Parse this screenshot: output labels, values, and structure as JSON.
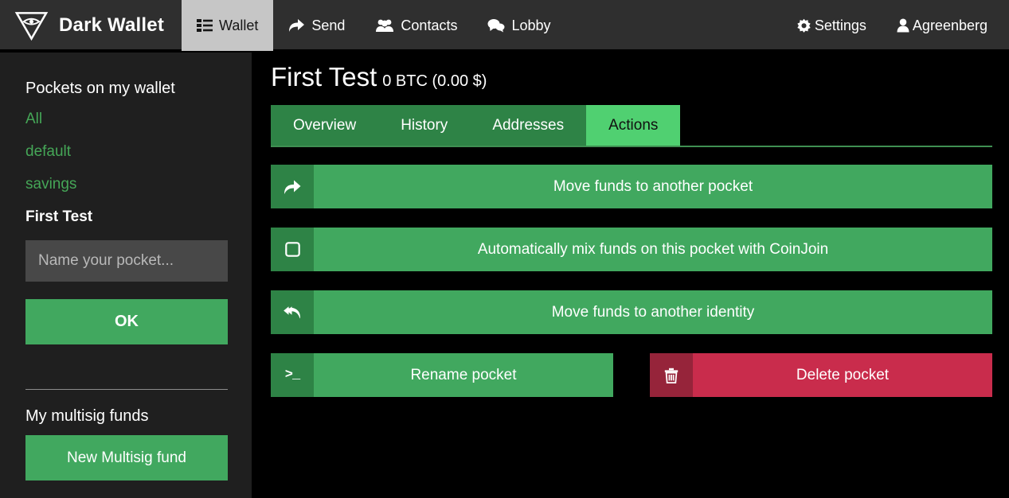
{
  "navbar": {
    "brand": "Dark Wallet",
    "brand_logo_icon": "triangle-eye-logo-icon",
    "items": [
      {
        "label": "Wallet",
        "icon": "list-icon",
        "active": true
      },
      {
        "label": "Send",
        "icon": "share-icon",
        "active": false
      },
      {
        "label": "Contacts",
        "icon": "users-icon",
        "active": false
      },
      {
        "label": "Lobby",
        "icon": "comments-icon",
        "active": false
      }
    ],
    "right_items": [
      {
        "label": "Settings",
        "icon": "gear-icon"
      },
      {
        "label": "Agreenberg",
        "icon": "user-icon"
      }
    ]
  },
  "sidebar": {
    "heading": "Pockets on my wallet",
    "pockets": [
      {
        "label": "All",
        "selected": false
      },
      {
        "label": "default",
        "selected": false
      },
      {
        "label": "savings",
        "selected": false
      },
      {
        "label": "First Test",
        "selected": true
      }
    ],
    "new_pocket_placeholder": "Name your pocket...",
    "new_pocket_value": "",
    "ok_label": "OK",
    "multisig_heading": "My multisig funds",
    "new_multisig_label": "New Multisig fund"
  },
  "main": {
    "title": "First Test",
    "balance": "0 BTC (0.00 $)",
    "tabs": [
      {
        "label": "Overview",
        "active": false
      },
      {
        "label": "History",
        "active": false
      },
      {
        "label": "Addresses",
        "active": false
      },
      {
        "label": "Actions",
        "active": true
      }
    ],
    "actions": [
      {
        "label": "Move funds to another pocket",
        "icon": "share-arrow-icon",
        "style": "green",
        "width": "full"
      },
      {
        "label": "Automatically mix funds on this pocket with CoinJoin",
        "icon": "checkbox-unchecked-icon",
        "style": "green",
        "width": "full"
      },
      {
        "label": "Move funds to another identity",
        "icon": "reply-all-icon",
        "style": "green",
        "width": "full"
      },
      {
        "label": "Rename pocket",
        "icon": "terminal-icon",
        "style": "green",
        "width": "half"
      },
      {
        "label": "Delete pocket",
        "icon": "trash-icon",
        "style": "danger",
        "width": "half"
      }
    ]
  },
  "colors": {
    "navbar_bg": "#2f2f2f",
    "navbar_active_bg": "#c6c6c6",
    "sidebar_bg": "#1f1f1f",
    "content_bg": "#000000",
    "green": "#41a85f",
    "green_dark": "#2e8346",
    "green_active_tab": "#50d071",
    "green_link": "#45a657",
    "danger": "#c92c4c",
    "danger_dark": "#96243a",
    "input_bg": "#484848"
  }
}
